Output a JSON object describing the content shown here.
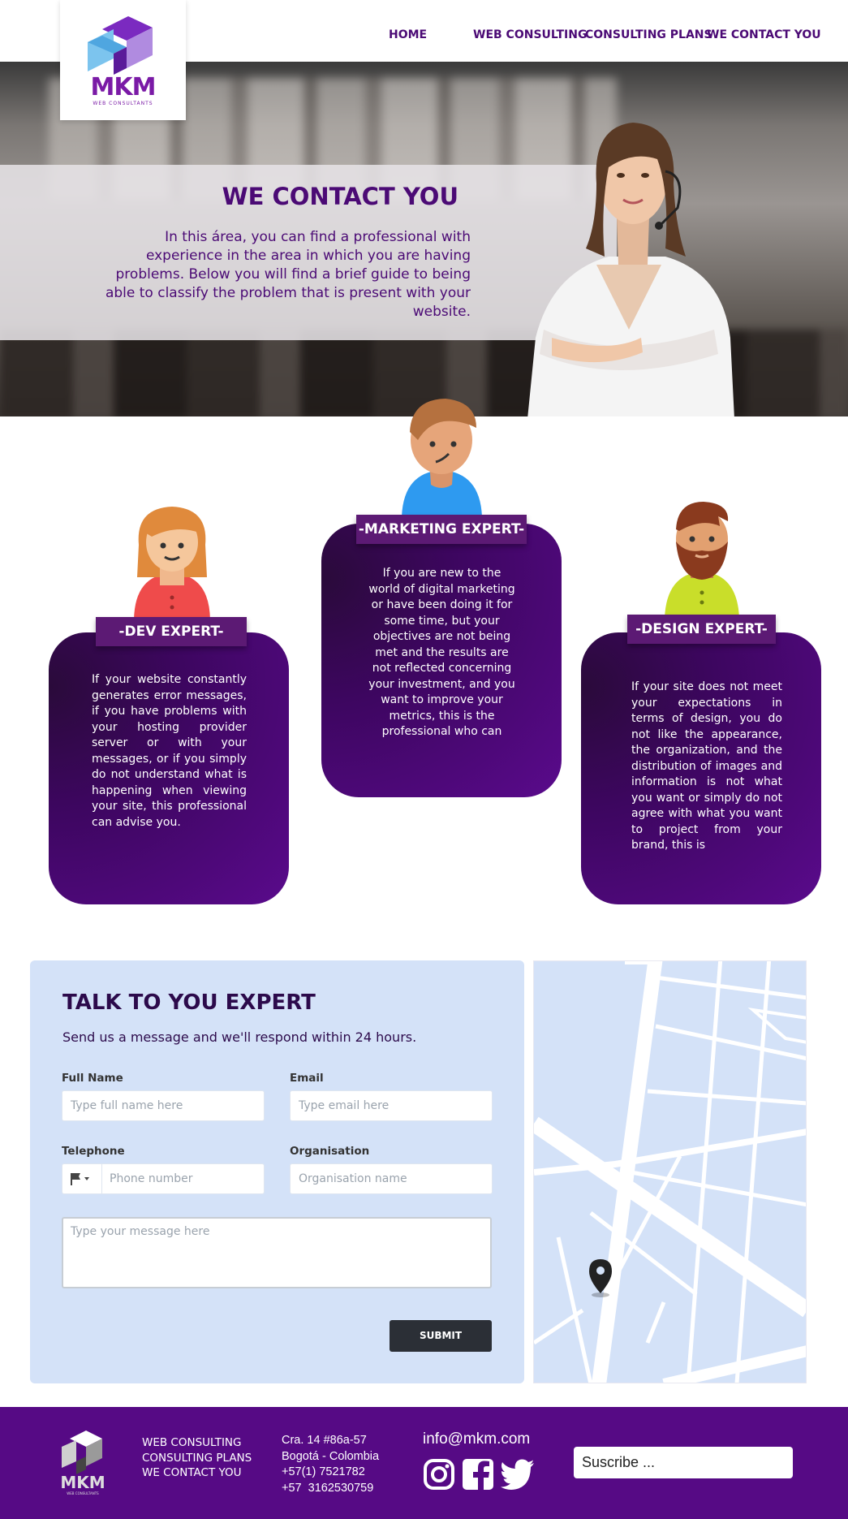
{
  "brand": {
    "logo_text": "MKM",
    "logo_sub": "WEB CONSULTANTS"
  },
  "nav": {
    "home": "HOME",
    "web_consulting": "WEB CONSULTING",
    "consulting_plans": "CONSULTING PLANS",
    "contact": "WE CONTACT YOU"
  },
  "hero": {
    "title": "WE CONTACT YOU",
    "text": "In this área, you can find a professional with experience in the area in which you are having problems. Below you will find a brief guide to being able to classify the problem that is present with your website."
  },
  "experts": [
    {
      "title": "-DEV EXPERT-",
      "text": "If your website constantly generates error messages, if you have problems with your hosting provider server or with your messages, or if you simply do not understand what is happening when viewing your site, this professional can advise you."
    },
    {
      "title": "-MARKETING EXPERT-",
      "text": "If you are new to the world of digital marketing or have been doing it for some time, but your objectives are not being met and the results are not reflected concerning your investment, and you want to improve your metrics, this is the professional who can"
    },
    {
      "title": "-DESIGN EXPERT-",
      "text": "If your site does not meet your expectations in terms of design, you do not like the appearance, the organization, and the distribution of images and information is not what you want or simply do not agree with what you want to project from your brand, this is"
    }
  ],
  "contact": {
    "title": "TALK TO YOU EXPERT",
    "subtitle": "Send us a message and we'll respond within 24 hours.",
    "full_name_label": "Full Name",
    "full_name_placeholder": "Type full name here",
    "email_label": "Email",
    "email_placeholder": "Type email here",
    "telephone_label": "Telephone",
    "telephone_placeholder": "Phone number",
    "organisation_label": "Organisation",
    "organisation_placeholder": "Organisation name",
    "message_placeholder": "Type your message here",
    "submit_label": "SUBMIT"
  },
  "footer": {
    "links": [
      "WEB CONSULTING",
      "CONSULTING PLANS",
      "WE CONTACT YOU"
    ],
    "address": [
      "Cra. 14 #86a-57",
      "Bogotá - Colombia",
      "+57(1) 7521782",
      "+57  3162530759"
    ],
    "email": "info@mkm.com",
    "subscribe_placeholder": "Suscribe ...",
    "social_icons": [
      "instagram-icon",
      "facebook-icon",
      "twitter-icon"
    ]
  },
  "colors": {
    "primary": "#560a85",
    "dark_purple": "#4b0a75",
    "card_light": "#d4e2f8"
  }
}
